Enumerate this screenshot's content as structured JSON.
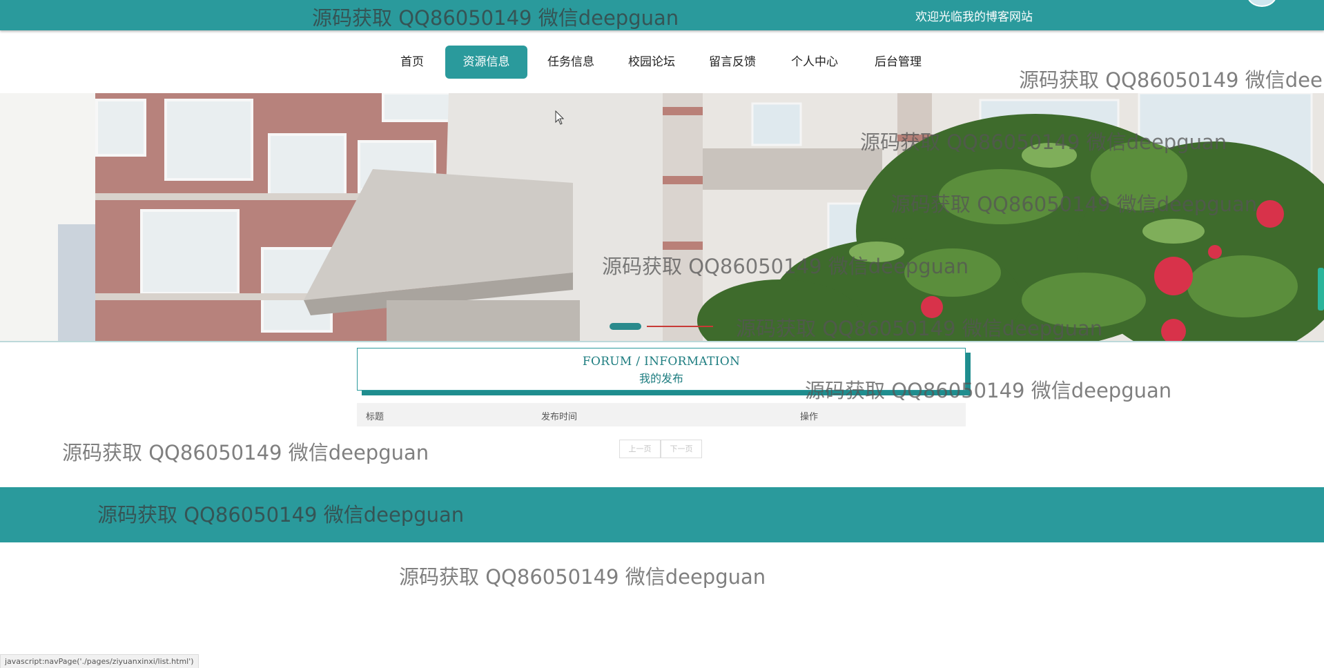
{
  "topbar": {
    "welcome": "欢迎光临我的博客网站"
  },
  "nav": {
    "items": [
      {
        "label": "首页"
      },
      {
        "label": "资源信息",
        "active": true
      },
      {
        "label": "任务信息"
      },
      {
        "label": "校园论坛"
      },
      {
        "label": "留言反馈"
      },
      {
        "label": "个人中心"
      },
      {
        "label": "后台管理"
      }
    ]
  },
  "section": {
    "title_en": "FORUM / INFORMATION",
    "title_cn": "我的发布"
  },
  "table": {
    "columns": [
      "标题",
      "发布时间",
      "操作"
    ]
  },
  "pager": {
    "prev": "上一页",
    "next": "下一页"
  },
  "watermark": {
    "text": "源码获取 QQ86050149 微信deepguan"
  },
  "statusbar": {
    "text": "javascript:navPage('./pages/ziyuanxinxi/list.html')"
  },
  "colors": {
    "primary": "#2a9a9c",
    "title_text": "#1e7d80",
    "footer": "#2a9a9c"
  },
  "icons": [
    "avatar-icon",
    "mouse-cursor-icon"
  ]
}
